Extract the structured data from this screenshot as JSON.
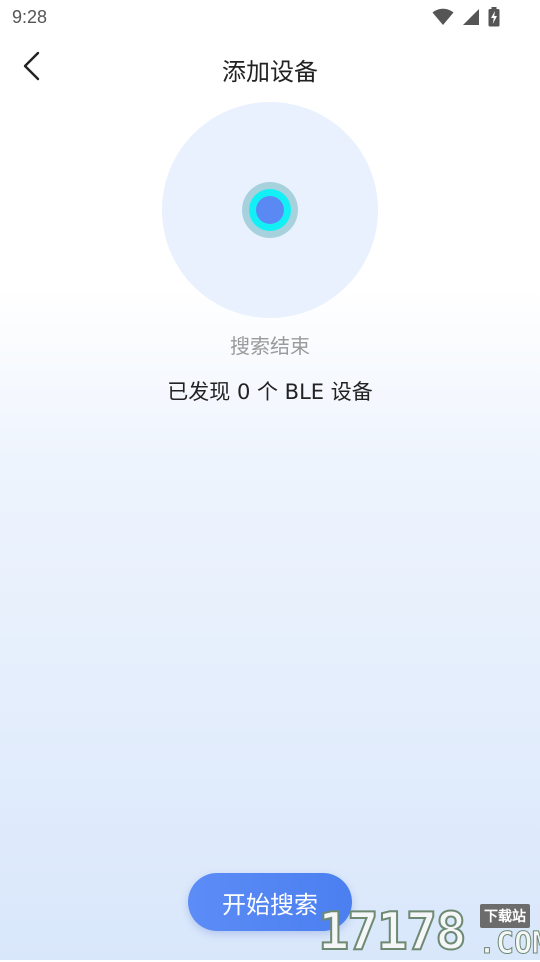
{
  "status_bar": {
    "time": "9:28",
    "icons": [
      "wifi-icon",
      "cellular-signal-icon",
      "battery-charging-icon"
    ]
  },
  "header": {
    "back_icon": "chevron-left-icon",
    "title": "添加设备"
  },
  "radar": {
    "colors": {
      "outer": "#e8f1fd",
      "halo": "#a7d2dd",
      "ring": "#13f0f5",
      "core": "#5b89f3"
    }
  },
  "status": {
    "search_state": "搜索结束",
    "found_text": "已发现 0 个 BLE 设备"
  },
  "actions": {
    "start_search_label": "开始搜索"
  },
  "watermark": {
    "digits": "17178",
    "domain": ".COM",
    "tag": "下载站"
  },
  "colors": {
    "accent": "#5c8cf6",
    "text_primary": "#222222",
    "text_secondary": "#9a9a9a"
  }
}
